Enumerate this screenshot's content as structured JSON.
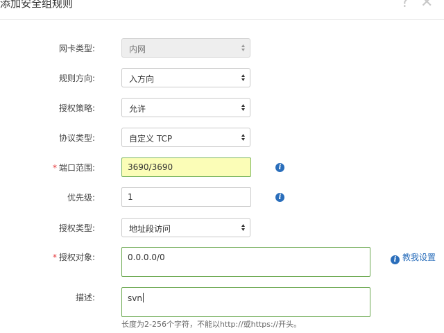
{
  "dialog": {
    "title": "添加安全组规则",
    "help_glyph": "?",
    "close_glyph": "✕"
  },
  "form": {
    "nic_type": {
      "label": "网卡类型:",
      "value": "内网",
      "disabled": true
    },
    "direction": {
      "label": "规则方向:",
      "value": "入方向"
    },
    "policy": {
      "label": "授权策略:",
      "value": "允许"
    },
    "protocol": {
      "label": "协议类型:",
      "value": "自定义 TCP"
    },
    "port_range": {
      "label": "端口范围:",
      "required_mark": "*",
      "value": "3690/3690"
    },
    "priority": {
      "label": "优先级:",
      "value": "1"
    },
    "auth_type": {
      "label": "授权类型:",
      "value": "地址段访问"
    },
    "auth_object": {
      "label": "授权对象:",
      "required_mark": "*",
      "value": "0.0.0.0/0",
      "help_link": "教我设置"
    },
    "description": {
      "label": "描述:",
      "value": "svn",
      "hint": "长度为2-256个字符，不能以http://或https://开头。"
    }
  },
  "icons": {
    "info": "i",
    "select_arrows": "chevron-up-down-icon"
  },
  "colors": {
    "link": "#2a6ebb",
    "required": "#e4393c",
    "highlight_bg": "#fbfdb7",
    "focus_border": "#6aa84f"
  }
}
